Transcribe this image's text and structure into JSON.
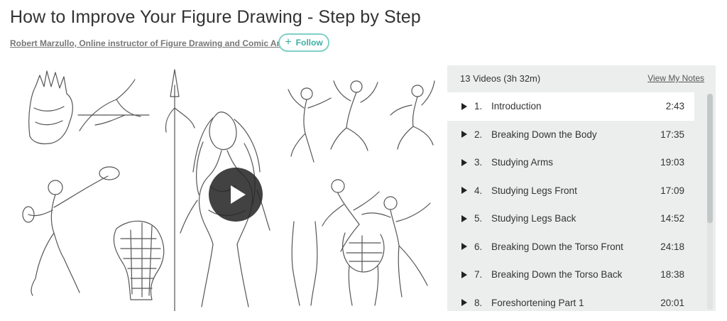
{
  "course": {
    "title": "How to Improve Your Figure Drawing - Step by Step",
    "author": "Robert Marzullo, Online instructor of Figure Drawing and Comic Art",
    "follow_label": "Follow"
  },
  "playlist": {
    "count_label": "13 Videos (3h 32m)",
    "notes_label": "View My Notes",
    "scroll_position": 0,
    "items": [
      {
        "num": "1.",
        "title": "Introduction",
        "duration": "2:43",
        "active": true
      },
      {
        "num": "2.",
        "title": "Breaking Down the Body",
        "duration": "17:35"
      },
      {
        "num": "3.",
        "title": "Studying Arms",
        "duration": "19:03"
      },
      {
        "num": "4.",
        "title": "Studying Legs Front",
        "duration": "17:09"
      },
      {
        "num": "5.",
        "title": "Studying Legs Back",
        "duration": "14:52"
      },
      {
        "num": "6.",
        "title": "Breaking Down the Torso Front",
        "duration": "24:18"
      },
      {
        "num": "7.",
        "title": "Breaking Down the Torso Back",
        "duration": "18:38"
      },
      {
        "num": "8.",
        "title": "Foreshortening Part 1",
        "duration": "20:01"
      }
    ]
  },
  "video": {
    "thumbnail": "figure-drawing-sketches",
    "play_icon": "play-icon"
  },
  "colors": {
    "accent": "#3cb0a4",
    "panel_bg": "#eceeee",
    "active_row": "#ffffff"
  }
}
